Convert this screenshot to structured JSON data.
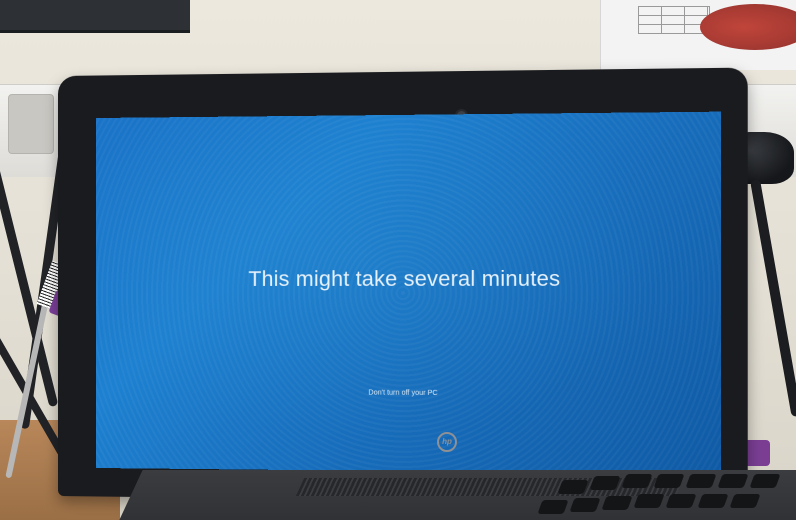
{
  "screen": {
    "main_message": "This might take several minutes",
    "sub_message": "Don't turn off your PC"
  },
  "laptop": {
    "brand_logo_text": "hp"
  },
  "colors": {
    "screen_blue": "#1a73c7",
    "bezel": "#1a1b1e",
    "text_white": "#e8f2fb"
  },
  "icons": [
    "hp-logo-icon",
    "webcam-icon",
    "power-plug-icon"
  ]
}
